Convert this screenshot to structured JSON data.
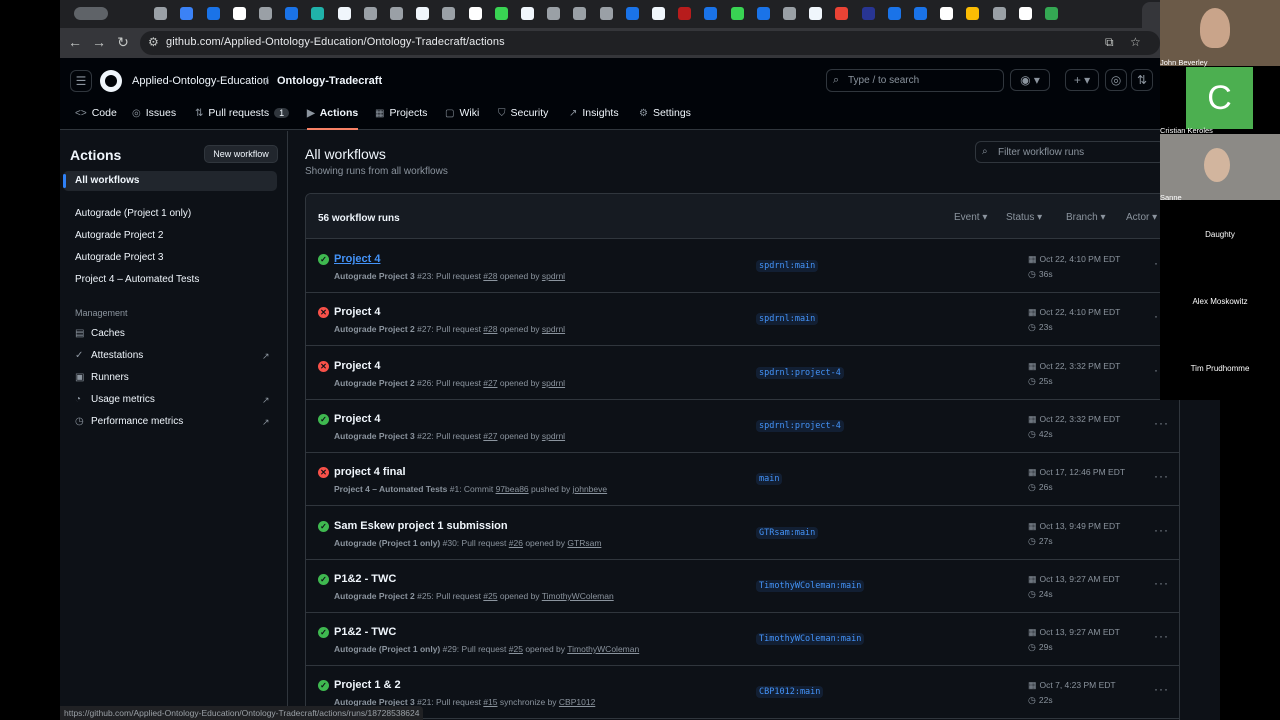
{
  "browser": {
    "url": "github.com/Applied-Ontology-Education/Ontology-Tradecraft/actions",
    "status_url": "https://github.com/Applied-Ontology-Education/Ontology-Tradecraft/actions/runs/18728538624"
  },
  "header": {
    "owner": "Applied-Ontology-Education",
    "separator": "/",
    "repo": "Ontology-Tradecraft",
    "search_placeholder": "Type / to search",
    "tabs": [
      {
        "label": "Code",
        "icon": "<>"
      },
      {
        "label": "Issues",
        "icon": "◎"
      },
      {
        "label": "Pull requests",
        "icon": "⇅",
        "count": "1"
      },
      {
        "label": "Actions",
        "icon": "▶"
      },
      {
        "label": "Projects",
        "icon": "▦"
      },
      {
        "label": "Wiki",
        "icon": "▢"
      },
      {
        "label": "Security",
        "icon": "⛉"
      },
      {
        "label": "Insights",
        "icon": "↗"
      },
      {
        "label": "Settings",
        "icon": "⚙"
      }
    ]
  },
  "sidebar": {
    "title": "Actions",
    "new_workflow": "New workflow",
    "workflows": [
      "All workflows",
      "Autograde (Project 1 only)",
      "Autograde Project 2",
      "Autograde Project 3",
      "Project 4 – Automated Tests"
    ],
    "management_label": "Management",
    "management": [
      {
        "label": "Caches",
        "icon": "▤"
      },
      {
        "label": "Attestations",
        "icon": "✓"
      },
      {
        "label": "Runners",
        "icon": "▣"
      },
      {
        "label": "Usage metrics",
        "icon": "◔"
      },
      {
        "label": "Performance metrics",
        "icon": "◷"
      }
    ]
  },
  "main": {
    "title": "All workflows",
    "subtitle": "Showing runs from all workflows",
    "filter_placeholder": "Filter workflow runs",
    "runs_count": "56 workflow runs",
    "filters": [
      "Event",
      "Status",
      "Branch",
      "Actor"
    ],
    "runs": [
      {
        "status": "success",
        "title": "Project 4",
        "workflow": "Autograde Project 3",
        "meta_a": " #23: Pull request ",
        "ref": "#28",
        "meta_b": " opened by ",
        "actor": "spdrnl",
        "branch": "spdrnl:main",
        "date": "Oct 22, 4:10 PM EDT",
        "duration": "36s"
      },
      {
        "status": "failure",
        "title": "Project 4",
        "workflow": "Autograde Project 2",
        "meta_a": " #27: Pull request ",
        "ref": "#28",
        "meta_b": " opened by ",
        "actor": "spdrnl",
        "branch": "spdrnl:main",
        "date": "Oct 22, 4:10 PM EDT",
        "duration": "23s"
      },
      {
        "status": "failure",
        "title": "Project 4",
        "workflow": "Autograde Project 2",
        "meta_a": " #26: Pull request ",
        "ref": "#27",
        "meta_b": " opened by ",
        "actor": "spdrnl",
        "branch": "spdrnl:project-4",
        "date": "Oct 22, 3:32 PM EDT",
        "duration": "25s"
      },
      {
        "status": "success",
        "title": "Project 4",
        "workflow": "Autograde Project 3",
        "meta_a": " #22: Pull request ",
        "ref": "#27",
        "meta_b": " opened by ",
        "actor": "spdrnl",
        "branch": "spdrnl:project-4",
        "date": "Oct 22, 3:32 PM EDT",
        "duration": "42s"
      },
      {
        "status": "failure",
        "title": "project 4 final",
        "workflow": "Project 4 – Automated Tests",
        "meta_a": " #1: Commit ",
        "ref": "97bea86",
        "meta_b": " pushed by ",
        "actor": "johnbeve",
        "branch": "main",
        "date": "Oct 17, 12:46 PM EDT",
        "duration": "26s"
      },
      {
        "status": "success",
        "title": "Sam Eskew project 1 submission",
        "workflow": "Autograde (Project 1 only)",
        "meta_a": " #30: Pull request ",
        "ref": "#26",
        "meta_b": " opened by ",
        "actor": "GTRsam",
        "branch": "GTRsam:main",
        "date": "Oct 13, 9:49 PM EDT",
        "duration": "27s"
      },
      {
        "status": "success",
        "title": "P1&2 - TWC",
        "workflow": "Autograde Project 2",
        "meta_a": " #25: Pull request ",
        "ref": "#25",
        "meta_b": " opened by ",
        "actor": "TimothyWColeman",
        "branch": "TimothyWColeman:main",
        "date": "Oct 13, 9:27 AM EDT",
        "duration": "24s"
      },
      {
        "status": "success",
        "title": "P1&2 - TWC",
        "workflow": "Autograde (Project 1 only)",
        "meta_a": " #29: Pull request ",
        "ref": "#25",
        "meta_b": " opened by ",
        "actor": "TimothyWColeman",
        "branch": "TimothyWColeman:main",
        "date": "Oct 13, 9:27 AM EDT",
        "duration": "29s"
      },
      {
        "status": "success",
        "title": "Project 1 & 2",
        "workflow": "Autograde Project 3",
        "meta_a": " #21: Pull request ",
        "ref": "#15",
        "meta_b": " synchronize by ",
        "actor": "CBP1012",
        "branch": "CBP1012:main",
        "date": "Oct 7, 4:23 PM EDT",
        "duration": "22s"
      }
    ]
  },
  "video": {
    "tiles": [
      {
        "name": "John Beverley"
      },
      {
        "name": "Cristian Keroles",
        "initial": "C"
      },
      {
        "name": "Sanne"
      }
    ],
    "audio_only": [
      "Daughty",
      "Alex Moskowitz",
      "Tim Prudhomme"
    ]
  },
  "colors": {
    "accent": "#f78166",
    "link": "#4493f8",
    "success": "#3fb950",
    "failure": "#f85149",
    "avatar_green": "#4caf50"
  }
}
